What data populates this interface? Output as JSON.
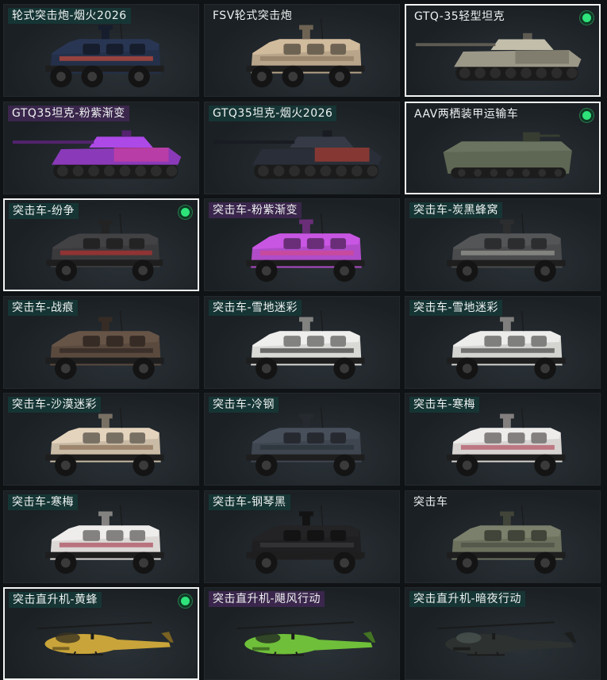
{
  "cards": [
    {
      "label": "轮式突击炮-烟火2026",
      "kind": "wheeled",
      "body": "#243049",
      "accent": "#c94a3a",
      "tag": "teal",
      "selected": false,
      "equipped": false
    },
    {
      "label": "FSV轮式突击炮",
      "kind": "wheeled",
      "body": "#b8a58a",
      "accent": "#8d7a62",
      "tag": "none",
      "selected": false,
      "equipped": false
    },
    {
      "label": "GTQ-35轻型坦克",
      "kind": "tank",
      "body": "#9c9888",
      "accent": "#6e6b5e",
      "tag": "none",
      "selected": true,
      "equipped": true
    },
    {
      "label": "GTQ35坦克-粉紫渐变",
      "kind": "tank",
      "body": "#8a3ab8",
      "accent": "#d8409a",
      "tag": "purple",
      "selected": false,
      "equipped": false
    },
    {
      "label": "GTQ35坦克-烟火2026",
      "kind": "tank",
      "body": "#2a2e38",
      "accent": "#c34030",
      "tag": "teal",
      "selected": false,
      "equipped": false
    },
    {
      "label": "AAV两栖装甲运输车",
      "kind": "aav",
      "body": "#5e6654",
      "accent": "#47503f",
      "tag": "none",
      "selected": true,
      "equipped": true
    },
    {
      "label": "突击车-纷争",
      "kind": "truck",
      "body": "#3a3a3c",
      "accent": "#b53030",
      "tag": "teal",
      "selected": true,
      "equipped": true
    },
    {
      "label": "突击车-粉紫渐变",
      "kind": "truck",
      "body": "#b04cc8",
      "accent": "#d24a8c",
      "tag": "purple",
      "selected": false,
      "equipped": false
    },
    {
      "label": "突击车-炭黑蜂窝",
      "kind": "truck",
      "body": "#4a4b4c",
      "accent": "#9a9a96",
      "tag": "teal",
      "selected": false,
      "equipped": false
    },
    {
      "label": "突击车-战痕",
      "kind": "truck",
      "body": "#5a4a3e",
      "accent": "#2d2622",
      "tag": "teal",
      "selected": false,
      "equipped": false
    },
    {
      "label": "突击车-雪地迷彩",
      "kind": "truck",
      "body": "#d9d9d6",
      "accent": "#3a3a3a",
      "tag": "teal",
      "selected": false,
      "equipped": false
    },
    {
      "label": "突击车-雪地迷彩",
      "kind": "truck",
      "body": "#d4d4d1",
      "accent": "#484848",
      "tag": "teal",
      "selected": false,
      "equipped": false
    },
    {
      "label": "突击车-沙漠迷彩",
      "kind": "truck",
      "body": "#c9bba6",
      "accent": "#8a6f55",
      "tag": "teal",
      "selected": false,
      "equipped": false
    },
    {
      "label": "突击车-冷钢",
      "kind": "truck",
      "body": "#3f4650",
      "accent": "#2a3038",
      "tag": "teal",
      "selected": false,
      "equipped": false
    },
    {
      "label": "突击车-寒梅",
      "kind": "truck",
      "body": "#d8d4d2",
      "accent": "#b25060",
      "tag": "teal",
      "selected": false,
      "equipped": false
    },
    {
      "label": "突击车-寒梅",
      "kind": "truck",
      "body": "#dcd8d6",
      "accent": "#a84858",
      "tag": "teal",
      "selected": false,
      "equipped": false
    },
    {
      "label": "突击车-钢琴黑",
      "kind": "truck",
      "body": "#1f1f21",
      "accent": "#3b3b3e",
      "tag": "teal",
      "selected": false,
      "equipped": false
    },
    {
      "label": "突击车",
      "kind": "truck",
      "body": "#6c715e",
      "accent": "#4c5043",
      "tag": "none",
      "selected": false,
      "equipped": false
    },
    {
      "label": "突击直升机-黄蜂",
      "kind": "heli",
      "body": "#c9a43a",
      "accent": "#3a3220",
      "tag": "teal",
      "selected": true,
      "equipped": true
    },
    {
      "label": "突击直升机-飓风行动",
      "kind": "heli",
      "body": "#6fbf3a",
      "accent": "#222822",
      "tag": "purple",
      "selected": false,
      "equipped": false
    },
    {
      "label": "突击直升机-暗夜行动",
      "kind": "heli",
      "body": "#2d3230",
      "accent": "#4a5250",
      "tag": "teal",
      "selected": false,
      "equipped": false
    }
  ]
}
